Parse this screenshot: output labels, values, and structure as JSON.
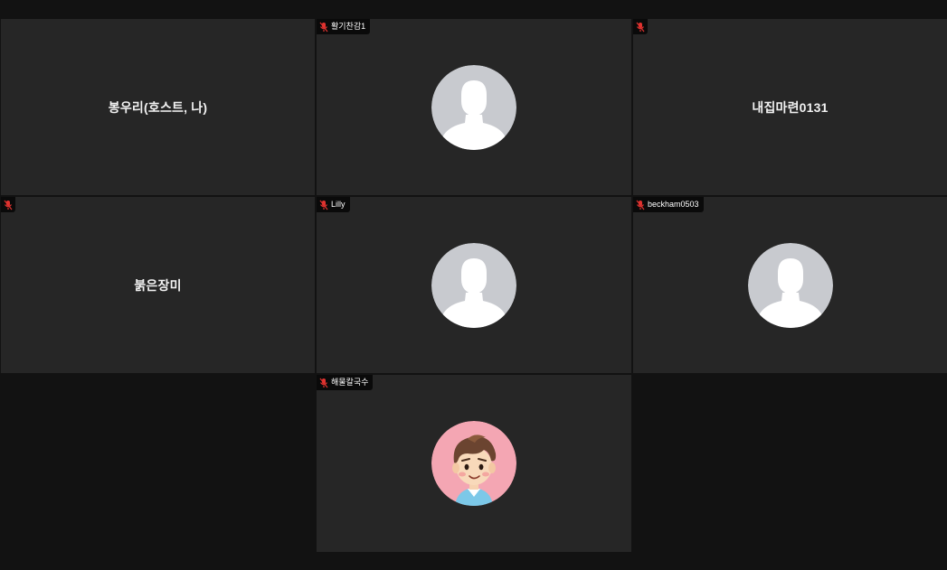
{
  "participants": [
    {
      "name": "봉우리(호스트, 나)",
      "label": "",
      "muted": false,
      "display": "name"
    },
    {
      "name": "",
      "label": "활기찬감1",
      "muted": true,
      "display": "placeholder-avatar"
    },
    {
      "name": "내집마련0131",
      "label": "",
      "muted": true,
      "display": "name"
    },
    {
      "name": "붉은장미",
      "label": "",
      "muted": true,
      "display": "name"
    },
    {
      "name": "",
      "label": "Lilly",
      "muted": true,
      "display": "placeholder-avatar"
    },
    {
      "name": "",
      "label": "beckham0503",
      "muted": true,
      "display": "placeholder-avatar"
    },
    {
      "name": "",
      "label": "해물칼국수",
      "muted": true,
      "display": "cartoon-avatar"
    }
  ],
  "icons": {
    "muted": "muted-mic-icon",
    "placeholder_avatar": "person-silhouette-icon",
    "custom_avatar": "cartoon-boy-avatar"
  },
  "colors": {
    "background": "#121212",
    "tile": "#262626",
    "avatar_bg": "#c8cacf",
    "avatar_silhouette": "#ffffff",
    "muted_icon": "#e0322f",
    "cartoon_bg": "#f4a6b3"
  }
}
